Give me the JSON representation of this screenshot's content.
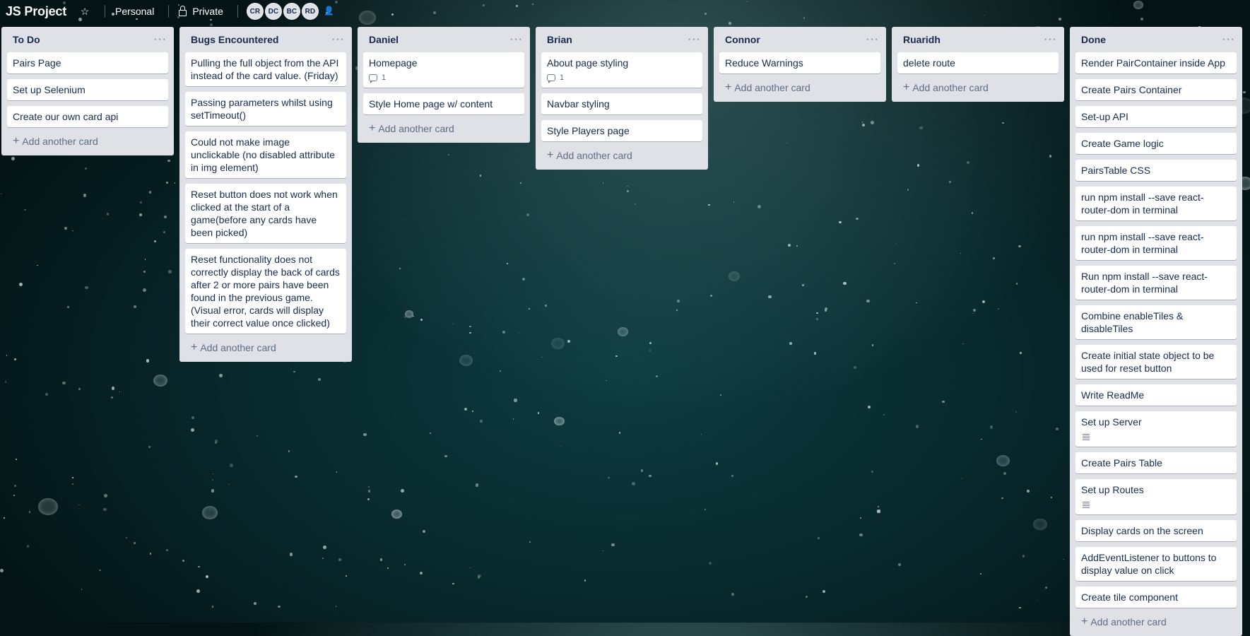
{
  "header": {
    "board_title": "JS Project",
    "star_icon": "star-icon",
    "team": "Personal",
    "visibility": "Private",
    "members": [
      "CR",
      "DC",
      "BC",
      "RD"
    ],
    "invite_icon": "add-member-icon"
  },
  "add_card_label": "Add another card",
  "list_menu": "···",
  "lists": [
    {
      "title": "To Do",
      "cards": [
        {
          "text": "Pairs Page"
        },
        {
          "text": "Set up Selenium"
        },
        {
          "text": "Create our own card api"
        }
      ]
    },
    {
      "title": "Bugs Encountered",
      "cards": [
        {
          "text": "Pulling the full object from the API instead of the card value. (Friday)"
        },
        {
          "text": "Passing parameters whilst using setTimeout()"
        },
        {
          "text": "Could not make image unclickable (no disabled attribute in img element)"
        },
        {
          "text": "Reset button does not work when clicked at the start of a game(before any cards have been picked)"
        },
        {
          "text": "Reset functionality does not correctly display the back of cards after 2 or more pairs have been found in the previous game. (Visual error, cards will display their correct value once clicked)"
        }
      ]
    },
    {
      "title": "Daniel",
      "cards": [
        {
          "text": "Homepage",
          "comments": "1"
        },
        {
          "text": "Style Home page w/ content"
        }
      ]
    },
    {
      "title": "Brian",
      "cards": [
        {
          "text": "About page styling",
          "comments": "1"
        },
        {
          "text": "Navbar styling"
        },
        {
          "text": "Style Players page"
        }
      ]
    },
    {
      "title": "Connor",
      "cards": [
        {
          "text": "Reduce Warnings"
        }
      ]
    },
    {
      "title": "Ruaridh",
      "cards": [
        {
          "text": "delete route"
        }
      ]
    },
    {
      "title": "Done",
      "cards": [
        {
          "text": "Render PairContainer inside App"
        },
        {
          "text": "Create Pairs Container"
        },
        {
          "text": "Set-up API"
        },
        {
          "text": "Create Game logic"
        },
        {
          "text": "PairsTable CSS"
        },
        {
          "text": "run npm install --save react-router-dom in terminal"
        },
        {
          "text": "run npm install --save react-router-dom in terminal"
        },
        {
          "text": "Run npm install --save react-router-dom in terminal"
        },
        {
          "text": "Combine enableTiles & disableTiles"
        },
        {
          "text": "Create initial state object to be used for reset button"
        },
        {
          "text": "Write ReadMe"
        },
        {
          "text": "Set up Server",
          "description": true
        },
        {
          "text": "Create Pairs Table"
        },
        {
          "text": "Set up Routes",
          "description": true
        },
        {
          "text": "Display cards on the screen"
        },
        {
          "text": "AddEventListener to buttons to display value on click"
        },
        {
          "text": "Create tile component"
        }
      ]
    }
  ]
}
